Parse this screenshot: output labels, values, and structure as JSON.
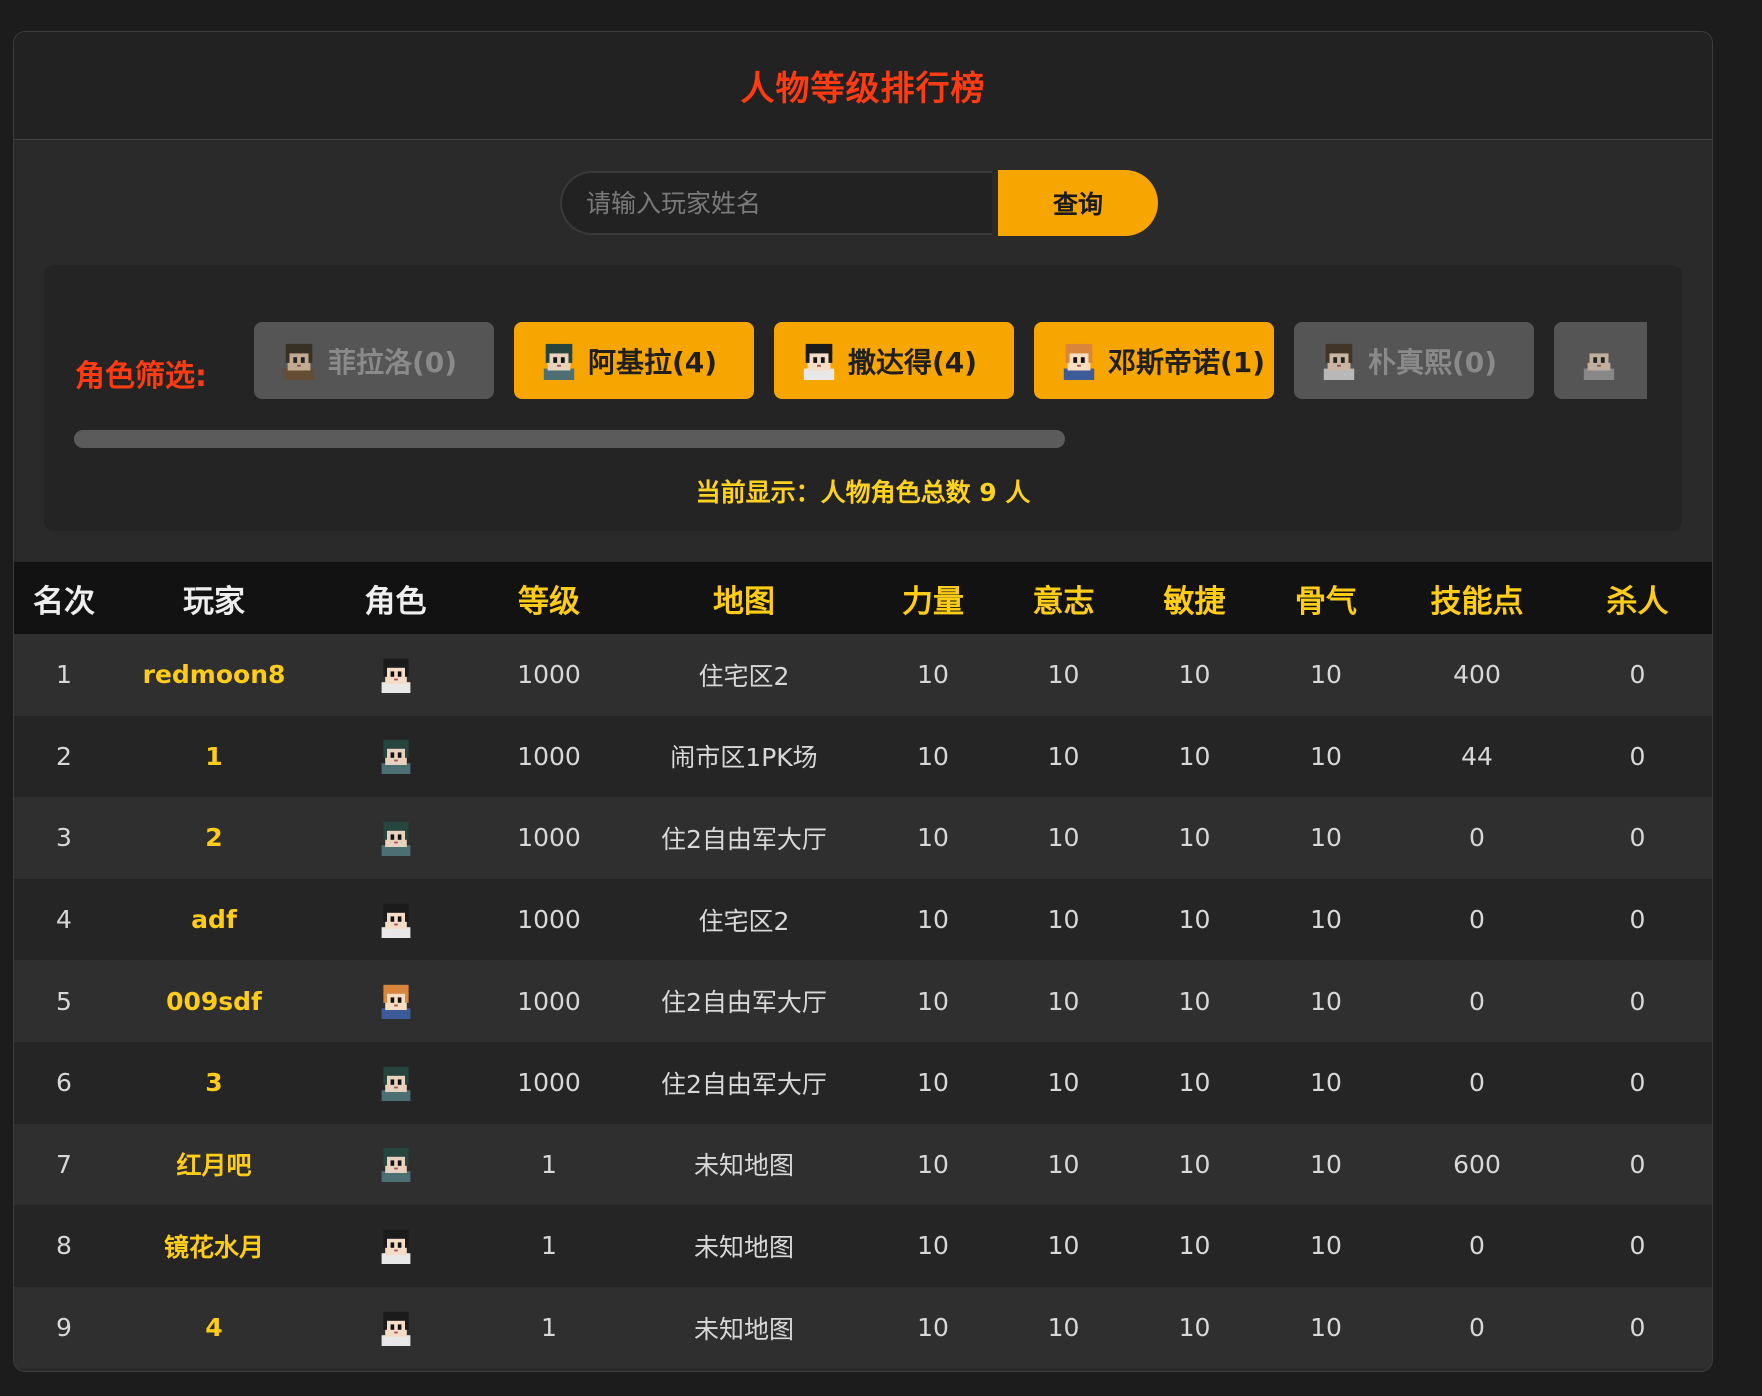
{
  "header": {
    "title": "人物等级排行榜"
  },
  "search": {
    "placeholder": "请输入玩家姓名",
    "value": "",
    "button_label": "查询"
  },
  "filter": {
    "label": "角色筛选:",
    "chips": [
      {
        "label": "菲拉洛(0)",
        "active": false,
        "icon": "character-avatar-icon"
      },
      {
        "label": "阿基拉(4)",
        "active": true,
        "icon": "character-avatar-icon"
      },
      {
        "label": "撒达得(4)",
        "active": true,
        "icon": "character-avatar-icon"
      },
      {
        "label": "邓斯帝诺(1)",
        "active": true,
        "icon": "character-avatar-icon"
      },
      {
        "label": "朴真熙(0)",
        "active": false,
        "icon": "character-avatar-icon"
      },
      {
        "label": "",
        "active": false,
        "icon": "character-avatar-icon"
      }
    ],
    "scroll_fraction": 0.63,
    "status": "当前显示：人物角色总数 9 人"
  },
  "table": {
    "headers": [
      "名次",
      "玩家",
      "角色",
      "等级",
      "地图",
      "力量",
      "意志",
      "敏捷",
      "骨气",
      "技能点",
      "杀人"
    ],
    "rows": [
      {
        "rank": "1",
        "player": "redmoon8",
        "role": "撒达得",
        "level": "1000",
        "map": "住宅区2",
        "str": "10",
        "will": "10",
        "agi": "10",
        "bone": "10",
        "skill": "400",
        "kills": "0"
      },
      {
        "rank": "2",
        "player": "1",
        "role": "阿基拉",
        "level": "1000",
        "map": "闹市区1PK场",
        "str": "10",
        "will": "10",
        "agi": "10",
        "bone": "10",
        "skill": "44",
        "kills": "0"
      },
      {
        "rank": "3",
        "player": "2",
        "role": "阿基拉",
        "level": "1000",
        "map": "住2自由军大厅",
        "str": "10",
        "will": "10",
        "agi": "10",
        "bone": "10",
        "skill": "0",
        "kills": "0"
      },
      {
        "rank": "4",
        "player": "adf",
        "role": "撒达得",
        "level": "1000",
        "map": "住宅区2",
        "str": "10",
        "will": "10",
        "agi": "10",
        "bone": "10",
        "skill": "0",
        "kills": "0"
      },
      {
        "rank": "5",
        "player": "009sdf",
        "role": "邓斯帝诺",
        "level": "1000",
        "map": "住2自由军大厅",
        "str": "10",
        "will": "10",
        "agi": "10",
        "bone": "10",
        "skill": "0",
        "kills": "0"
      },
      {
        "rank": "6",
        "player": "3",
        "role": "阿基拉",
        "level": "1000",
        "map": "住2自由军大厅",
        "str": "10",
        "will": "10",
        "agi": "10",
        "bone": "10",
        "skill": "0",
        "kills": "0"
      },
      {
        "rank": "7",
        "player": "红月吧",
        "role": "阿基拉",
        "level": "1",
        "map": "未知地图",
        "str": "10",
        "will": "10",
        "agi": "10",
        "bone": "10",
        "skill": "600",
        "kills": "0"
      },
      {
        "rank": "8",
        "player": "镜花水月",
        "role": "撒达得",
        "level": "1",
        "map": "未知地图",
        "str": "10",
        "will": "10",
        "agi": "10",
        "bone": "10",
        "skill": "0",
        "kills": "0"
      },
      {
        "rank": "9",
        "player": "4",
        "role": "撒达得",
        "level": "1",
        "map": "未知地图",
        "str": "10",
        "will": "10",
        "agi": "10",
        "bone": "10",
        "skill": "0",
        "kills": "0"
      }
    ]
  },
  "colors": {
    "accent_orange": "#f7a500",
    "title_red": "#ff3b13",
    "gold_text": "#ffcc17"
  }
}
